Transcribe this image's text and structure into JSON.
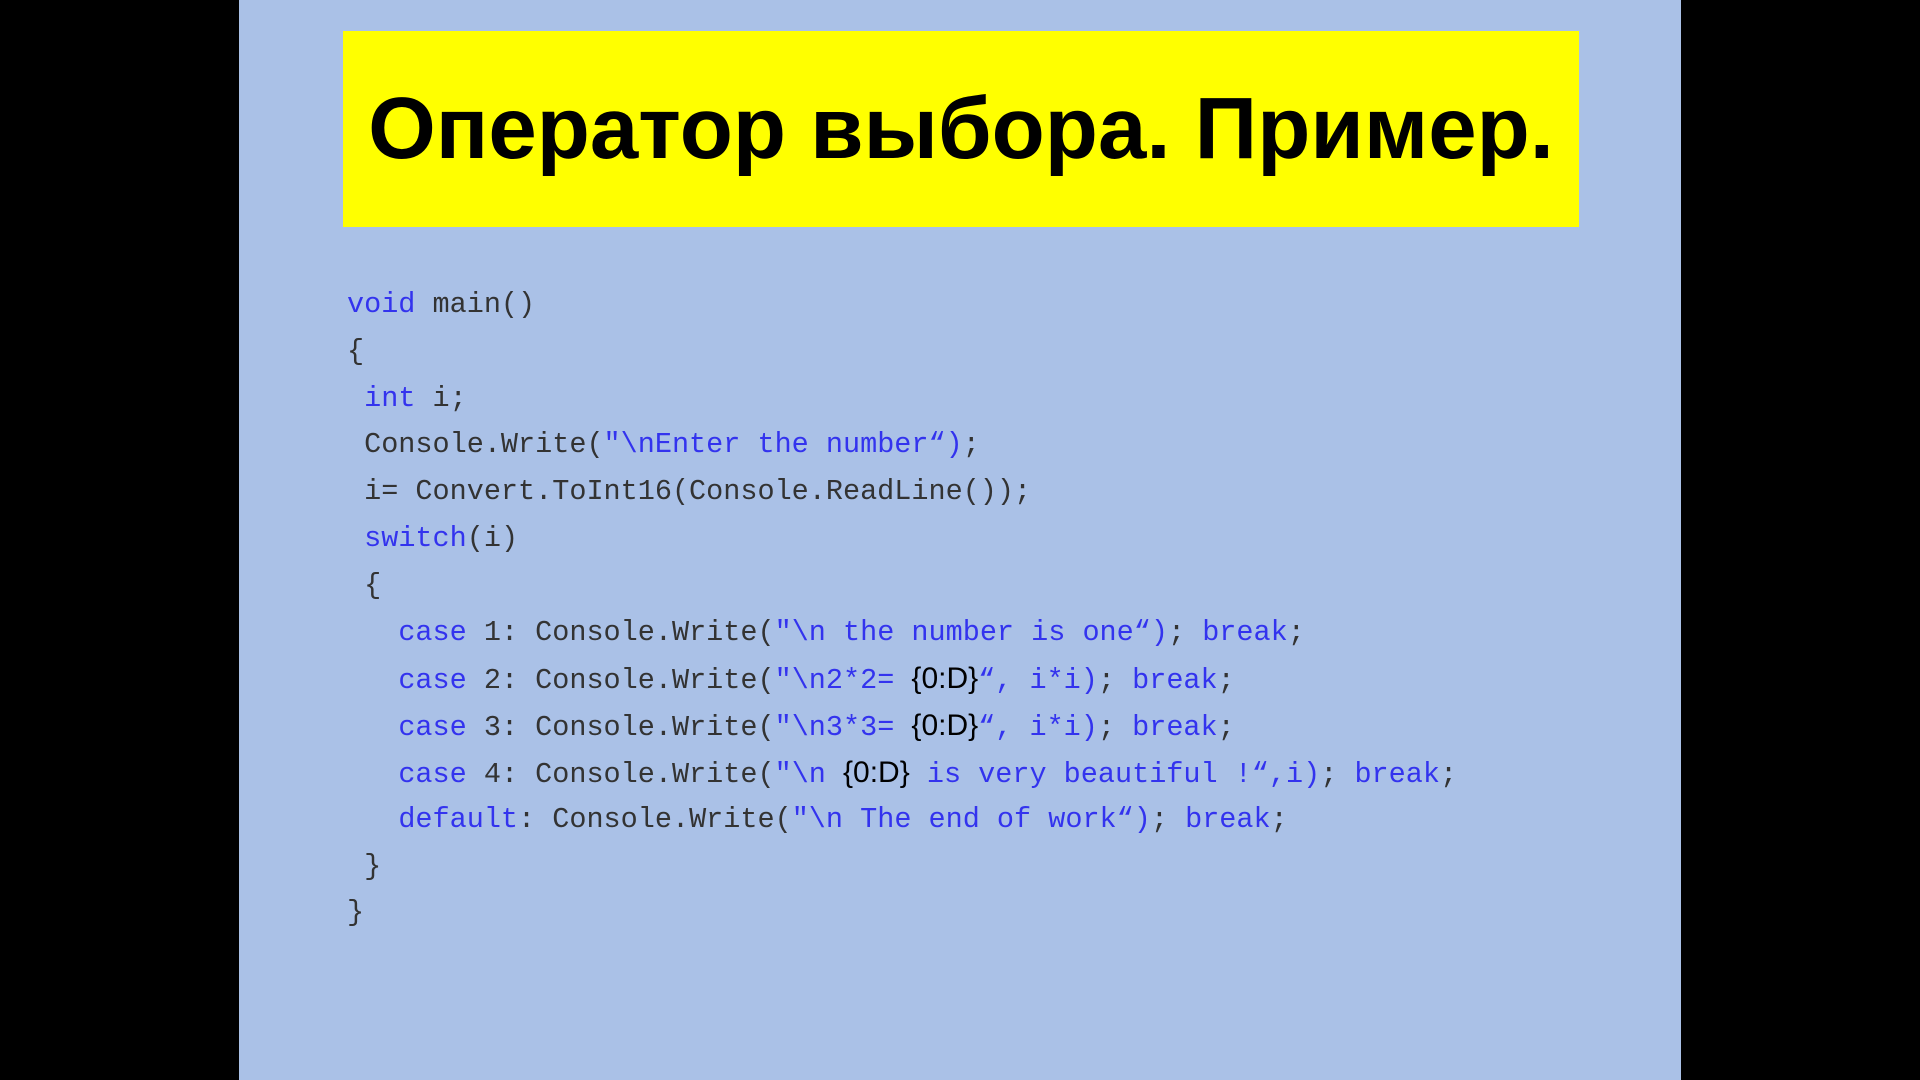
{
  "slide": {
    "background": "#aac1e7",
    "title": "Оператор выбора. Пример.",
    "title_background": "#ffff00",
    "keyword_color": "#3333ee",
    "text_color": "#333333"
  },
  "code_lines": [
    [
      {
        "t": "kw",
        "v": "void"
      },
      {
        "t": "tx",
        "v": " main()"
      }
    ],
    [
      {
        "t": "tx",
        "v": "{"
      }
    ],
    [
      {
        "t": "tx",
        "v": " "
      },
      {
        "t": "kw",
        "v": "int"
      },
      {
        "t": "tx",
        "v": " i;"
      }
    ],
    [
      {
        "t": "tx",
        "v": " Console.Write("
      },
      {
        "t": "str",
        "v": "\"\\nEnter the number“)"
      },
      {
        "t": "tx",
        "v": ";"
      }
    ],
    [
      {
        "t": "tx",
        "v": " i= Convert.ToInt16(Console.ReadLine());"
      }
    ],
    [
      {
        "t": "tx",
        "v": " "
      },
      {
        "t": "kw",
        "v": "switch"
      },
      {
        "t": "tx",
        "v": "(i)"
      }
    ],
    [
      {
        "t": "tx",
        "v": " {"
      }
    ],
    [
      {
        "t": "tx",
        "v": "   "
      },
      {
        "t": "kw",
        "v": "case"
      },
      {
        "t": "tx",
        "v": " 1: Console.Write("
      },
      {
        "t": "str",
        "v": "\"\\n the number is one“)"
      },
      {
        "t": "tx",
        "v": "; "
      },
      {
        "t": "kw",
        "v": "break"
      },
      {
        "t": "tx",
        "v": ";"
      }
    ],
    [
      {
        "t": "tx",
        "v": "   "
      },
      {
        "t": "kw",
        "v": "case"
      },
      {
        "t": "tx",
        "v": " 2: Console.Write("
      },
      {
        "t": "str",
        "v": "\"\\n2*2= "
      },
      {
        "t": "fmt",
        "v": "{0:D}"
      },
      {
        "t": "str",
        "v": "“, i*i)"
      },
      {
        "t": "tx",
        "v": "; "
      },
      {
        "t": "kw",
        "v": "break"
      },
      {
        "t": "tx",
        "v": ";"
      }
    ],
    [
      {
        "t": "tx",
        "v": "   "
      },
      {
        "t": "kw",
        "v": "case"
      },
      {
        "t": "tx",
        "v": " 3: Console.Write("
      },
      {
        "t": "str",
        "v": "\"\\n3*3= "
      },
      {
        "t": "fmt",
        "v": "{0:D}"
      },
      {
        "t": "str",
        "v": "“, i*i)"
      },
      {
        "t": "tx",
        "v": "; "
      },
      {
        "t": "kw",
        "v": "break"
      },
      {
        "t": "tx",
        "v": ";"
      }
    ],
    [
      {
        "t": "tx",
        "v": "   "
      },
      {
        "t": "kw",
        "v": "case"
      },
      {
        "t": "tx",
        "v": " 4: Console.Write("
      },
      {
        "t": "str",
        "v": "\"\\n "
      },
      {
        "t": "fmt",
        "v": "{0:D}"
      },
      {
        "t": "str",
        "v": " is very beautiful !“,i)"
      },
      {
        "t": "tx",
        "v": "; "
      },
      {
        "t": "kw",
        "v": "break"
      },
      {
        "t": "tx",
        "v": ";"
      }
    ],
    [
      {
        "t": "tx",
        "v": "   "
      },
      {
        "t": "kw",
        "v": "default"
      },
      {
        "t": "tx",
        "v": ": Console.Write("
      },
      {
        "t": "str",
        "v": "\"\\n The end of work“)"
      },
      {
        "t": "tx",
        "v": "; "
      },
      {
        "t": "kw",
        "v": "break"
      },
      {
        "t": "tx",
        "v": ";"
      }
    ],
    [
      {
        "t": "tx",
        "v": " }"
      }
    ],
    [
      {
        "t": "tx",
        "v": "}"
      }
    ]
  ]
}
